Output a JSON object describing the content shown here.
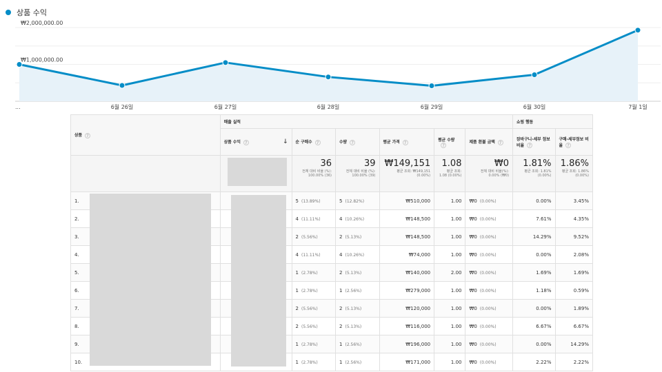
{
  "chart": {
    "legend_label": "상품 수익",
    "series_color": "#058dc7",
    "y_tick_labels": [
      "₩2,000,000.00",
      "₩1,000,000.00"
    ],
    "x_tick_labels": [
      "...",
      "6월 26일",
      "6월 27일",
      "6월 28일",
      "6월 29일",
      "6월 30일",
      "7월 1일"
    ]
  },
  "chart_data": {
    "type": "area",
    "x": [
      "",
      "6월 26일",
      "6월 27일",
      "6월 28일",
      "6월 29일",
      "6월 30일",
      "7월 1일"
    ],
    "series": [
      {
        "name": "상품 수익",
        "values": [
          1000000,
          430000,
          1050000,
          660000,
          420000,
          720000,
          1930000
        ]
      }
    ],
    "ylim": [
      0,
      2000000
    ],
    "grid": true,
    "legend": "top-left"
  },
  "table": {
    "header_group_sales": "매출 실적",
    "header_group_shopping": "쇼핑 행동",
    "col_product": "상품",
    "col_revenue": "상품 수익",
    "col_purchases": "순 구매수",
    "col_quantity": "수량",
    "col_avg_price": "평균 가격",
    "col_avg_qty": "평균 수량",
    "col_refund": "제품 환불 금액",
    "col_cart_detail": "장바구니-세부 정보 비율",
    "col_buy_detail": "구매-세부정보 비율",
    "totals": {
      "purchases": "36",
      "purchases_sub": "전체 대비 비율 (%): 100.00% (36)",
      "quantity": "39",
      "quantity_sub": "전체 대비 비율 (%): 100.00% (39)",
      "avg_price": "₩149,151",
      "avg_price_sub": "평균 조회: ₩149,151 (0.00%)",
      "avg_qty": "1.08",
      "avg_qty_sub": "평균 조회: 1.08 (0.00%)",
      "refund": "₩0",
      "refund_sub": "전체 대비 비율(%): 0.00% (₩0)",
      "cart_detail": "1.81%",
      "cart_detail_sub": "평균 조회: 1.81% (0.00%)",
      "buy_detail": "1.86%",
      "buy_detail_sub": "평균 조회: 1.86% (0.00%)"
    },
    "rows": [
      {
        "idx": "1.",
        "purchases": "5",
        "purchases_pct": "(13.89%)",
        "quantity": "5",
        "quantity_pct": "(12.82%)",
        "avg_price": "₩510,000",
        "avg_qty": "1.00",
        "refund": "₩0",
        "refund_pct": "(0.00%)",
        "cart": "0.00%",
        "buy": "3.45%"
      },
      {
        "idx": "2.",
        "purchases": "4",
        "purchases_pct": "(11.11%)",
        "quantity": "4",
        "quantity_pct": "(10.26%)",
        "avg_price": "₩148,500",
        "avg_qty": "1.00",
        "refund": "₩0",
        "refund_pct": "(0.00%)",
        "cart": "7.61%",
        "buy": "4.35%"
      },
      {
        "idx": "3.",
        "purchases": "2",
        "purchases_pct": "(5.56%)",
        "quantity": "2",
        "quantity_pct": "(5.13%)",
        "avg_price": "₩148,500",
        "avg_qty": "1.00",
        "refund": "₩0",
        "refund_pct": "(0.00%)",
        "cart": "14.29%",
        "buy": "9.52%"
      },
      {
        "idx": "4.",
        "purchases": "4",
        "purchases_pct": "(11.11%)",
        "quantity": "4",
        "quantity_pct": "(10.26%)",
        "avg_price": "₩74,000",
        "avg_qty": "1.00",
        "refund": "₩0",
        "refund_pct": "(0.00%)",
        "cart": "0.00%",
        "buy": "2.08%"
      },
      {
        "idx": "5.",
        "purchases": "1",
        "purchases_pct": "(2.78%)",
        "quantity": "2",
        "quantity_pct": "(5.13%)",
        "avg_price": "₩140,000",
        "avg_qty": "2.00",
        "refund": "₩0",
        "refund_pct": "(0.00%)",
        "cart": "1.69%",
        "buy": "1.69%"
      },
      {
        "idx": "6.",
        "purchases": "1",
        "purchases_pct": "(2.78%)",
        "quantity": "1",
        "quantity_pct": "(2.56%)",
        "avg_price": "₩279,000",
        "avg_qty": "1.00",
        "refund": "₩0",
        "refund_pct": "(0.00%)",
        "cart": "1.18%",
        "buy": "0.59%"
      },
      {
        "idx": "7.",
        "purchases": "2",
        "purchases_pct": "(5.56%)",
        "quantity": "2",
        "quantity_pct": "(5.13%)",
        "avg_price": "₩120,000",
        "avg_qty": "1.00",
        "refund": "₩0",
        "refund_pct": "(0.00%)",
        "cart": "0.00%",
        "buy": "1.89%"
      },
      {
        "idx": "8.",
        "purchases": "2",
        "purchases_pct": "(5.56%)",
        "quantity": "2",
        "quantity_pct": "(5.13%)",
        "avg_price": "₩116,000",
        "avg_qty": "1.00",
        "refund": "₩0",
        "refund_pct": "(0.00%)",
        "cart": "6.67%",
        "buy": "6.67%"
      },
      {
        "idx": "9.",
        "purchases": "1",
        "purchases_pct": "(2.78%)",
        "quantity": "1",
        "quantity_pct": "(2.56%)",
        "avg_price": "₩196,000",
        "avg_qty": "1.00",
        "refund": "₩0",
        "refund_pct": "(0.00%)",
        "cart": "0.00%",
        "buy": "14.29%"
      },
      {
        "idx": "10.",
        "purchases": "1",
        "purchases_pct": "(2.78%)",
        "quantity": "1",
        "quantity_pct": "(2.56%)",
        "avg_price": "₩171,000",
        "avg_qty": "1.00",
        "refund": "₩0",
        "refund_pct": "(0.00%)",
        "cart": "2.22%",
        "buy": "2.22%"
      }
    ]
  }
}
